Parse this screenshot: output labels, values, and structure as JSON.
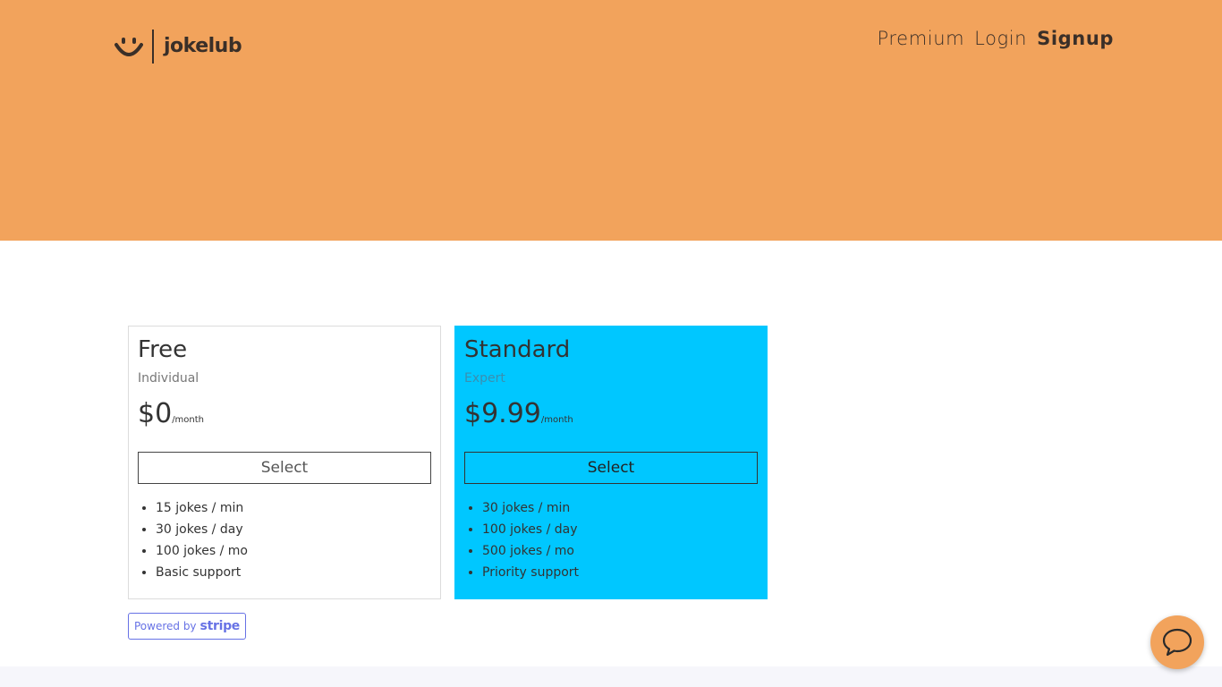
{
  "header": {
    "logo_text": "jokelub",
    "nav": [
      {
        "label": "Premium"
      },
      {
        "label": "Login"
      },
      {
        "label": "Signup"
      }
    ]
  },
  "plans": [
    {
      "name": "Free",
      "tier": "Individual",
      "price": "$0",
      "period": "/month",
      "select_label": "Select",
      "features": [
        "15 jokes / min",
        "30 jokes / day",
        "100 jokes / mo",
        "Basic support"
      ]
    },
    {
      "name": "Standard",
      "tier": "Expert",
      "price": "$9.99",
      "period": "/month",
      "select_label": "Select",
      "features": [
        "30 jokes / min",
        "100 jokes / day",
        "500 jokes / mo",
        "Priority support"
      ]
    }
  ],
  "stripe_badge": {
    "powered_by": "Powered by",
    "brand": "stripe"
  },
  "colors": {
    "hero": "#f2a35c",
    "standard_plan": "#00c7ff",
    "stripe": "#6772e5"
  },
  "icons": {
    "logo": "smile-icon",
    "chat": "chat-bubble-icon"
  }
}
